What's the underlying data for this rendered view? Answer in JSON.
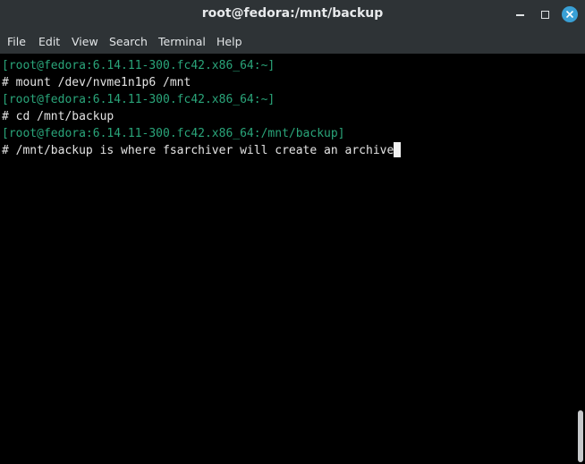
{
  "window": {
    "title": "root@fedora:/mnt/backup",
    "controls": {
      "minimize_icon": "minimize-icon",
      "maximize_icon": "maximize-icon",
      "close_icon": "close-icon"
    }
  },
  "menubar": {
    "items": [
      "File",
      "Edit",
      "View",
      "Search",
      "Terminal",
      "Help"
    ]
  },
  "terminal": {
    "lines": [
      {
        "type": "prompt",
        "text": "[root@fedora:6.14.11-300.fc42.x86_64:~]"
      },
      {
        "type": "command",
        "text": "# mount /dev/nvme1n1p6 /mnt"
      },
      {
        "type": "prompt",
        "text": "[root@fedora:6.14.11-300.fc42.x86_64:~]"
      },
      {
        "type": "command",
        "text": "# cd /mnt/backup"
      },
      {
        "type": "prompt",
        "text": "[root@fedora:6.14.11-300.fc42.x86_64:/mnt/backup]"
      },
      {
        "type": "command",
        "text": "# /mnt/backup is where fsarchiver will create an archive"
      }
    ]
  },
  "colors": {
    "titlebar_bg": "#2e3336",
    "terminal_bg": "#000000",
    "prompt_green": "#2aa57a",
    "command_text": "#e4e4e4",
    "close_button": "#39a0d6"
  }
}
